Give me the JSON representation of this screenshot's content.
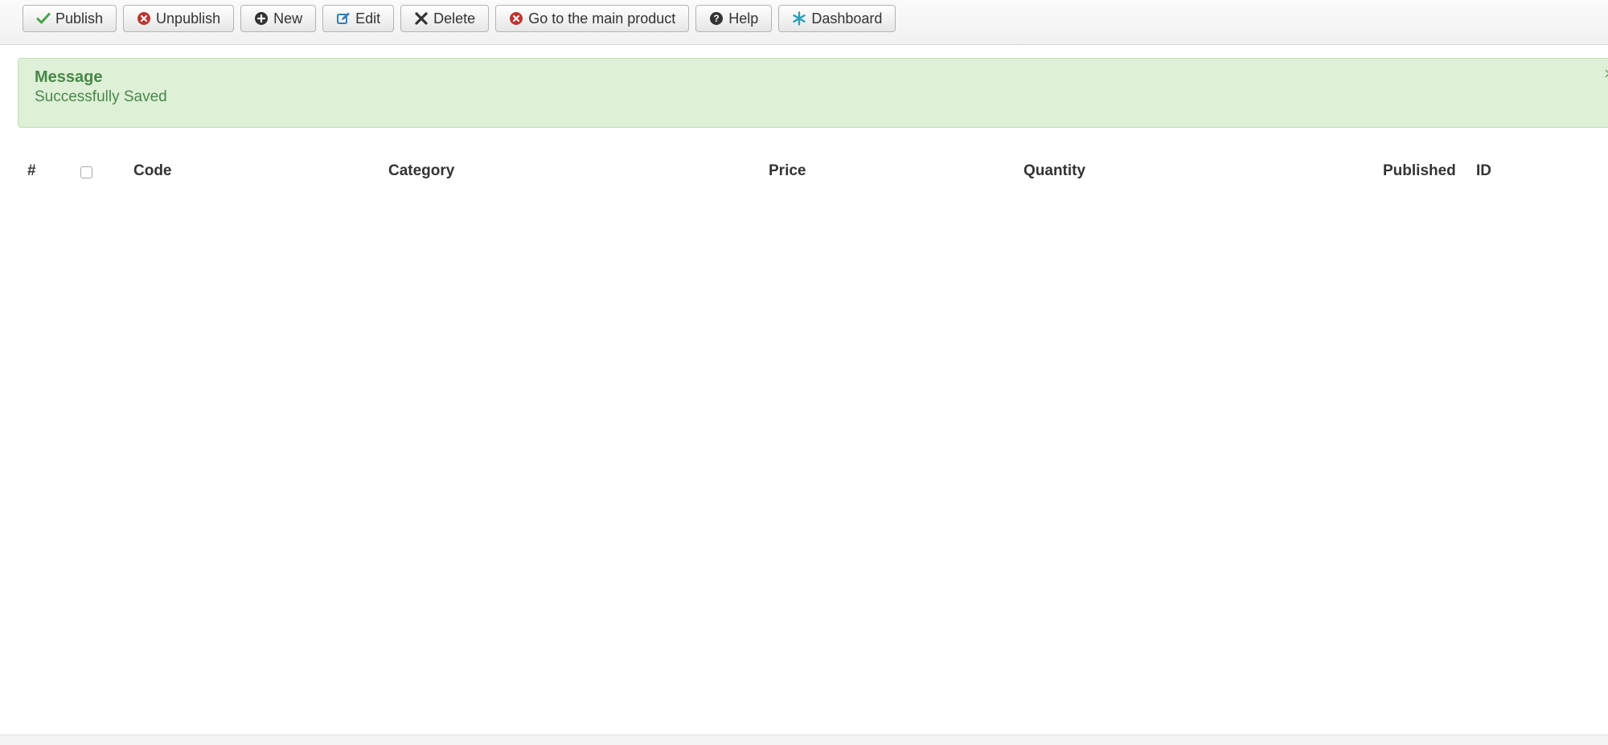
{
  "toolbar": {
    "buttons": [
      {
        "label": "Publish",
        "icon": "check-icon"
      },
      {
        "label": "Unpublish",
        "icon": "circle-x-icon"
      },
      {
        "label": "New",
        "icon": "circle-plus-icon"
      },
      {
        "label": "Edit",
        "icon": "edit-icon"
      },
      {
        "label": "Delete",
        "icon": "x-icon"
      },
      {
        "label": "Go to the main product",
        "icon": "circle-x-icon"
      },
      {
        "label": "Help",
        "icon": "question-circle-icon"
      },
      {
        "label": "Dashboard",
        "icon": "asterisk-icon"
      }
    ]
  },
  "message": {
    "heading": "Message",
    "text": "Successfully Saved",
    "close_label": "×"
  },
  "table": {
    "columns": [
      "#",
      "Code",
      "Category",
      "Price",
      "Quantity",
      "Published",
      "ID"
    ],
    "rows": []
  },
  "colors": {
    "success_text": "#468847",
    "success_bg": "#dff0d8",
    "publish_green": "#46a546",
    "unpublish_red": "#bd362f",
    "edit_blue": "#2f7fc1",
    "dashboard_teal": "#2a9fb8"
  }
}
